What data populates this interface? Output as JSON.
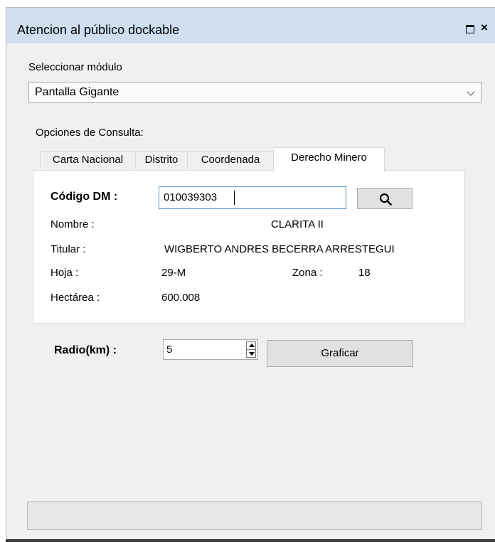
{
  "window": {
    "title": "Atencion al público dockable",
    "maximize_icon": "maximize-icon",
    "close_label": "×"
  },
  "module": {
    "label": "Seleccionar módulo",
    "selected": "Pantalla Gigante"
  },
  "options": {
    "label": "Opciones de Consulta:",
    "tabs": [
      "Carta Nacional",
      "Distrito",
      "Coordenada",
      "Derecho Minero"
    ],
    "active_tab": "Derecho Minero"
  },
  "dm": {
    "code_label": "Código DM :",
    "code_value": "010039303",
    "search_icon": "search-icon",
    "nombre_label": "Nombre :",
    "nombre_value": "CLARITA II",
    "titular_label": "Titular :",
    "titular_value": "WIGBERTO ANDRES BECERRA ARRESTEGUI",
    "hoja_label": "Hoja :",
    "hoja_value": "29-M",
    "zona_label": "Zona :",
    "zona_value": "18",
    "hectarea_label": "Hectárea :",
    "hectarea_value": "600.008"
  },
  "radio": {
    "label": "Radio(km) :",
    "value": "5",
    "graph_button": "Graficar"
  }
}
